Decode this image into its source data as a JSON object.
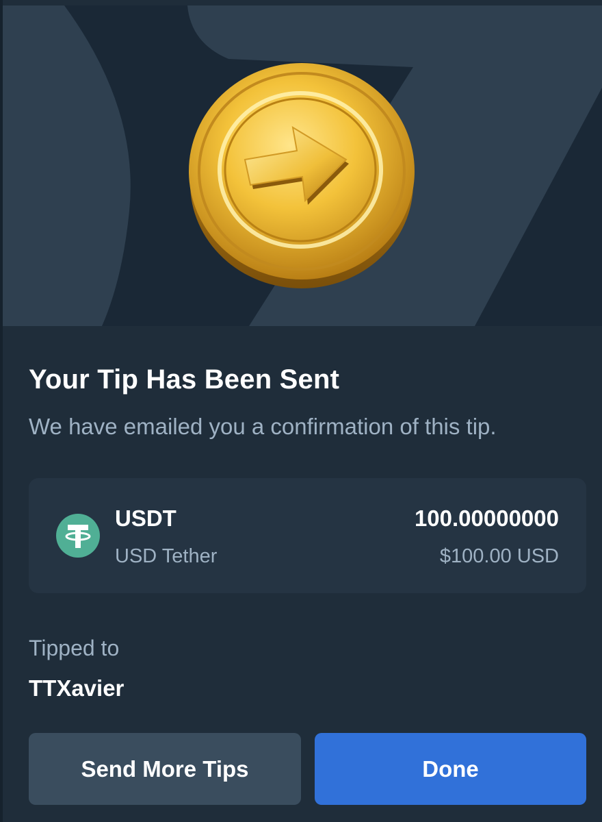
{
  "hero": {
    "illustration_icon": "gold-coin-arrow-icon"
  },
  "confirmation": {
    "title": "Your Tip Has Been Sent",
    "subtitle": "We have emailed you a confirmation of this tip."
  },
  "currency": {
    "icon": "tether-icon",
    "code": "USDT",
    "name": "USD Tether",
    "amount": "100.00000000",
    "fiat_value": "$100.00 USD"
  },
  "recipient": {
    "label": "Tipped to",
    "username": "TTXavier"
  },
  "actions": {
    "send_more_label": "Send More Tips",
    "done_label": "Done"
  },
  "colors": {
    "background": "#1f2d3a",
    "card": "#253443",
    "secondary_button": "#3a4d5e",
    "primary_button": "#3171d9",
    "tether_green": "#50af95",
    "muted_text": "#9fb2c4"
  }
}
